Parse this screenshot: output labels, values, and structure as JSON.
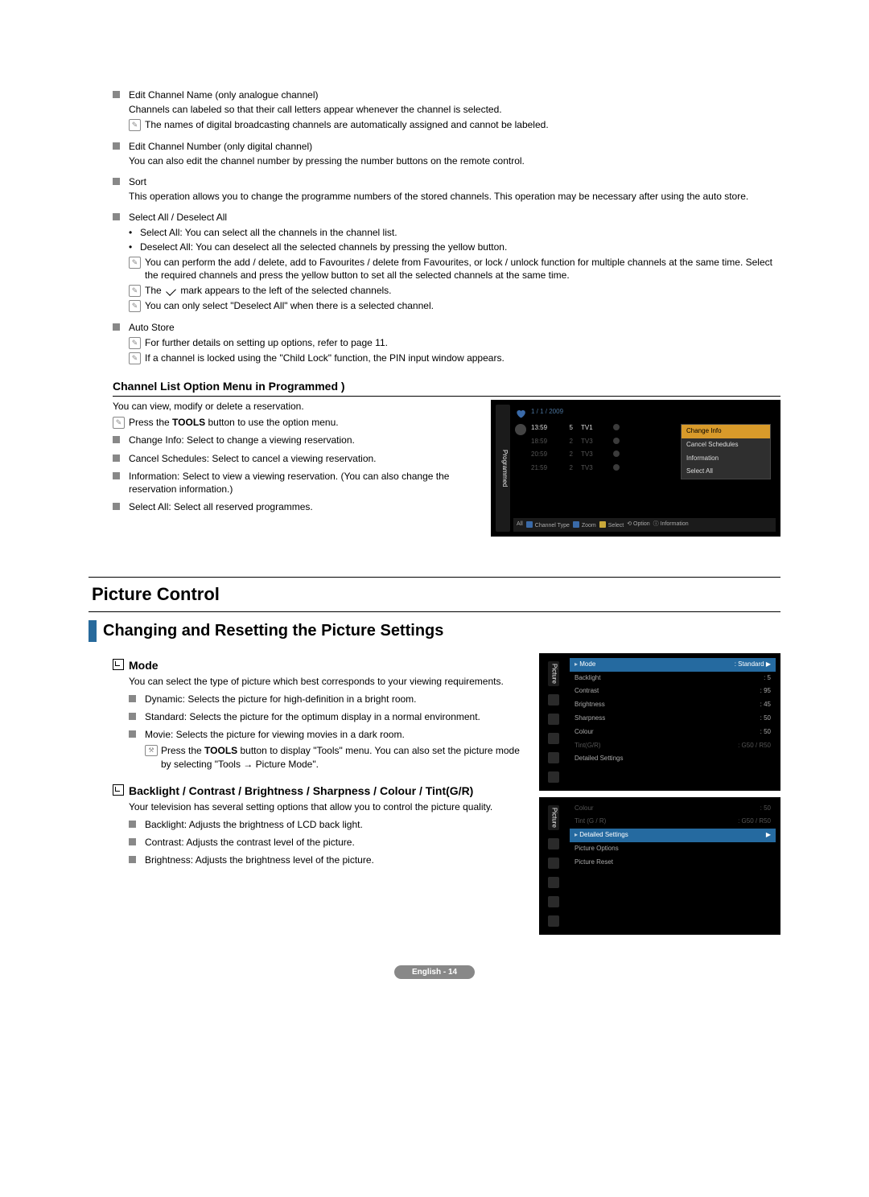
{
  "section1": {
    "items": [
      {
        "title": "Edit Channel Name (only analogue channel)",
        "desc": "Channels can labeled so that their call letters appear whenever the channel is selected.",
        "notes": [
          "The names of digital broadcasting channels are automatically assigned and cannot be labeled."
        ]
      },
      {
        "title": "Edit Channel Number (only digital channel)",
        "desc": "You can also edit the channel number by pressing the number buttons on the remote control."
      },
      {
        "title": "Sort",
        "desc": "This operation allows you to change the programme numbers of the stored channels. This operation may be necessary after using the auto store."
      },
      {
        "title": "Select All / Deselect All",
        "bullets": [
          "Select All: You can select all the channels in the channel list.",
          "Deselect All: You can deselect all the selected channels by pressing the yellow button."
        ],
        "notes": [
          "You can perform the add / delete, add to Favourites / delete from Favourites, or lock / unlock function for multiple channels at the same time. Select the required channels and press the yellow button to set all the selected channels at the same time.",
          "The  ✓  mark appears to the left of the selected channels.",
          "You can only select \"Deselect All\" when there is a selected channel."
        ],
        "checkNote": true
      },
      {
        "title": "Auto Store",
        "notes": [
          "For further details on setting up options, refer to page 11.",
          "If a channel is locked using the \"Child Lock\" function, the PIN input window appears."
        ]
      }
    ]
  },
  "section2": {
    "heading": "Channel List Option Menu in Programmed )",
    "intro": "You can view, modify or delete a reservation.",
    "firstNote": {
      "pre": "Press the ",
      "bold": "TOOLS",
      "post": " button to use the option menu."
    },
    "items": [
      "Change Info: Select to change a viewing reservation.",
      "Cancel Schedules: Select to cancel a viewing reservation.",
      "Information: Select to view a viewing reservation. (You can also change the reservation information.)",
      "Select All: Select all reserved programmes."
    ]
  },
  "tvshot": {
    "tab": "Programmed",
    "date": "1 / 1 / 2009",
    "rows": [
      {
        "time": "13:59",
        "ch": "5",
        "name": "TV1",
        "active": true
      },
      {
        "time": "18:59",
        "ch": "2",
        "name": "TV3",
        "active": false
      },
      {
        "time": "20:59",
        "ch": "2",
        "name": "TV3",
        "active": false
      },
      {
        "time": "21:59",
        "ch": "2",
        "name": "TV3",
        "active": false
      }
    ],
    "menu": [
      "Change Info",
      "Cancel Schedules",
      "Information",
      "Select All"
    ],
    "bottom": {
      "all": "All",
      "ct": "Channel Type",
      "zoom": "Zoom",
      "sel": "Select",
      "opt": "Option",
      "info": "Information"
    }
  },
  "picture": {
    "part": "Picture Control",
    "subpart": "Changing and Resetting the Picture Settings",
    "mode": {
      "title": "Mode",
      "intro": "You can select the type of picture which best corresponds to your viewing requirements.",
      "items": [
        "Dynamic: Selects the picture for high-definition in a bright room.",
        "Standard: Selects the picture for the optimum display in a normal environment.",
        "Movie: Selects the picture for viewing movies in a dark room."
      ],
      "toolnote": {
        "pre": "Press the ",
        "bold": "TOOLS",
        "post": " button to display \"Tools\" menu. You can also set the picture mode by selecting \"Tools → Picture Mode\"."
      }
    },
    "adj": {
      "title": "Backlight / Contrast / Brightness / Sharpness / Colour / Tint(G/R)",
      "intro": "Your television has several setting options that allow you to control the picture quality.",
      "items": [
        "Backlight: Adjusts the brightness of LCD back light.",
        "Contrast: Adjusts the contrast level of the picture.",
        "Brightness: Adjusts the brightness level of the picture."
      ]
    }
  },
  "setbox1": {
    "tab": "Picture",
    "rows": [
      {
        "l": "Mode",
        "r": ": Standard",
        "sel": true,
        "arrow": true,
        "dotBefore": true
      },
      {
        "l": "Backlight",
        "r": ": 5"
      },
      {
        "l": "Contrast",
        "r": ": 95"
      },
      {
        "l": "Brightness",
        "r": ": 45"
      },
      {
        "l": "Sharpness",
        "r": ": 50"
      },
      {
        "l": "Colour",
        "r": ": 50"
      },
      {
        "l": "Tint(G/R)",
        "r": ": G50 / R50",
        "dim": true
      },
      {
        "l": "Detailed Settings",
        "r": ""
      }
    ]
  },
  "setbox2": {
    "tab": "Picture",
    "rows": [
      {
        "l": "Colour",
        "r": ": 50",
        "dim": true,
        "above": true
      },
      {
        "l": "Tint (G / R)",
        "r": ": G50 / R50",
        "dim": true,
        "above": true
      },
      {
        "l": "Detailed Settings",
        "r": "",
        "sel": true,
        "arrow": true,
        "dotBefore": true
      },
      {
        "l": "Picture Options",
        "r": ""
      },
      {
        "l": "Picture Reset",
        "r": ""
      }
    ]
  },
  "footer": "English - 14"
}
